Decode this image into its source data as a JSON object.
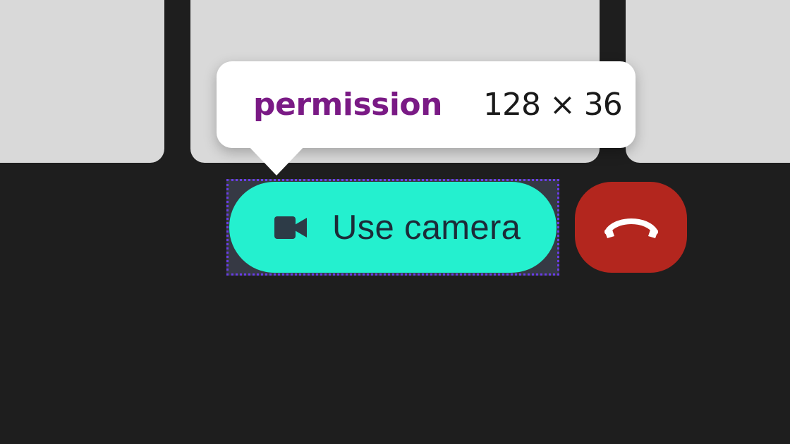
{
  "inspector_tooltip": {
    "element_name": "permission",
    "dimensions": "128 × 36"
  },
  "controls": {
    "camera_button": {
      "label": "Use camera",
      "icon": "video-camera-icon"
    },
    "hangup_button": {
      "icon": "phone-hangup-icon"
    }
  },
  "colors": {
    "background": "#1e1e1e",
    "tile": "#d9d9d9",
    "camera_button": "#24f0cf",
    "camera_button_text": "#1c2b38",
    "hangup_button": "#b3261e",
    "tooltip_tag": "#7a1a85",
    "highlight_outline": "#6a3de8"
  }
}
